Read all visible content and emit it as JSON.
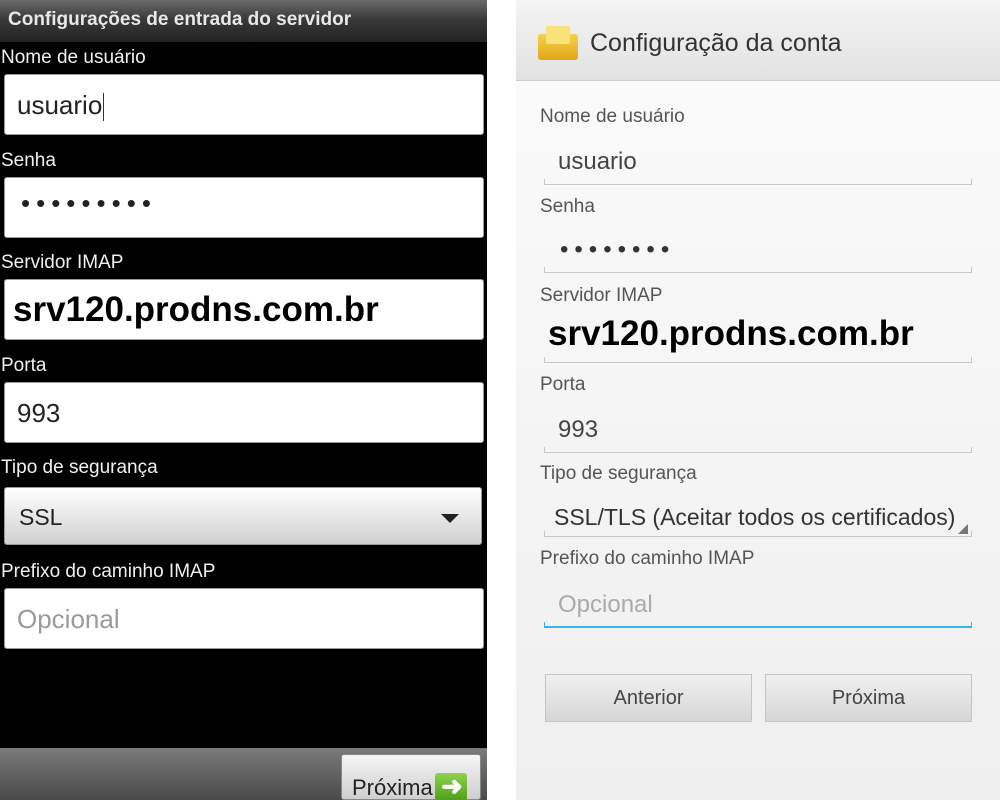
{
  "left": {
    "title": "Configurações de entrada do servidor",
    "username_label": "Nome de usuário",
    "username_value": "usuario",
    "password_label": "Senha",
    "password_value": "•••••••••",
    "server_label": "Servidor IMAP",
    "server_value": "srv120.prodns.com.br",
    "port_label": "Porta",
    "port_value": "993",
    "security_label": "Tipo de segurança",
    "security_value": "SSL",
    "prefix_label": "Prefixo do caminho IMAP",
    "prefix_placeholder": "Opcional",
    "next_label": "Próxima",
    "next_icon": "green-arrow-right-icon"
  },
  "right": {
    "title": "Configuração da conta",
    "app_icon": "email-envelope-icon",
    "username_label": "Nome de usuário",
    "username_value": "usuario",
    "password_label": "Senha",
    "password_value": "••••••••",
    "server_label": "Servidor IMAP",
    "server_value": "srv120.prodns.com.br",
    "port_label": "Porta",
    "port_value": "993",
    "security_label": "Tipo de segurança",
    "security_value": "SSL/TLS (Aceitar todos os certificados)",
    "prefix_label": "Prefixo do caminho IMAP",
    "prefix_placeholder": "Opcional",
    "prev_label": "Anterior",
    "next_label": "Próxima",
    "focus_color": "#33b5e5"
  }
}
